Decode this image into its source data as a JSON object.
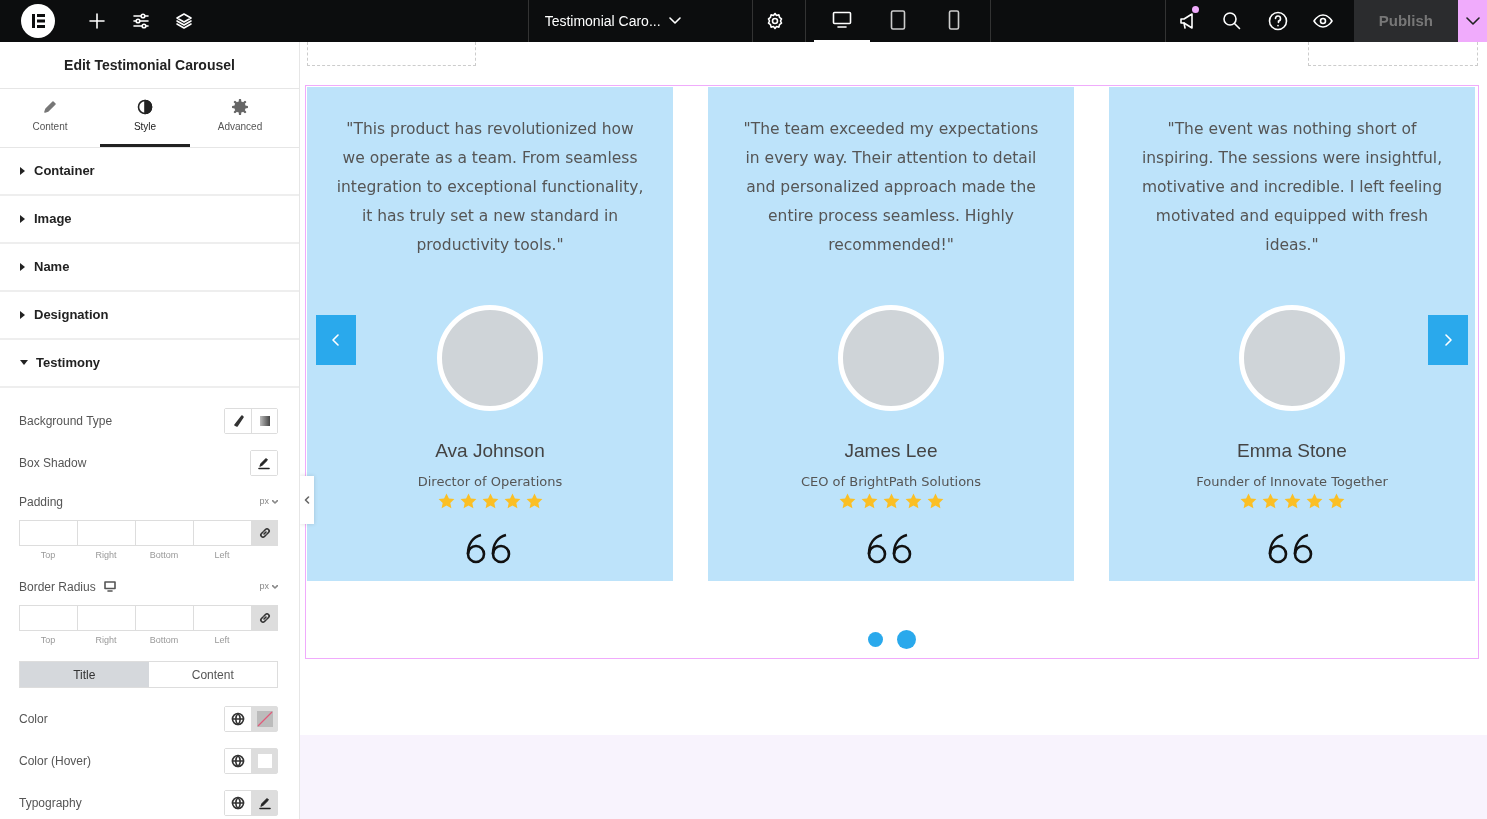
{
  "topbar": {
    "document_title": "Testimonial Caro...",
    "publish": "Publish",
    "devices": [
      {
        "kind": "desktop",
        "selected": true
      },
      {
        "kind": "tablet",
        "selected": false
      },
      {
        "kind": "mobile",
        "selected": false
      }
    ],
    "notification": true
  },
  "panel": {
    "title": "Edit Testimonial Carousel",
    "tabs": [
      {
        "label": "Content",
        "kind": "content",
        "selected": false
      },
      {
        "label": "Style",
        "kind": "style",
        "selected": true
      },
      {
        "label": "Advanced",
        "kind": "advanced",
        "selected": false
      }
    ],
    "sections": [
      {
        "label": "Container",
        "expanded": false
      },
      {
        "label": "Image",
        "expanded": false
      },
      {
        "label": "Name",
        "expanded": false
      },
      {
        "label": "Designation",
        "expanded": false
      },
      {
        "label": "Testimony",
        "expanded": true
      }
    ],
    "controls": [
      {
        "kind": "choose",
        "label": "Background Type"
      },
      {
        "kind": "edit",
        "label": "Box Shadow"
      },
      {
        "kind": "dimensions",
        "label": "Padding",
        "unit": "px",
        "responsive": false,
        "sides": [
          "Top",
          "Right",
          "Bottom",
          "Left"
        ]
      },
      {
        "kind": "dimensions",
        "label": "Border Radius",
        "unit": "px",
        "responsive": true,
        "sides": [
          "Top",
          "Right",
          "Bottom",
          "Left"
        ]
      },
      {
        "kind": "switch",
        "options": [
          {
            "label": "Title",
            "selected": true
          },
          {
            "label": "Content",
            "selected": false
          }
        ]
      },
      {
        "kind": "color",
        "label": "Color",
        "cleared": true
      },
      {
        "kind": "color",
        "label": "Color (Hover)",
        "cleared": false
      },
      {
        "kind": "typography",
        "label": "Typography"
      }
    ]
  },
  "carousel": {
    "slides": [
      {
        "quote": "\"This product has revolutionized how we operate as a team. From seamless integration to exceptional functionality, it has truly set a new standard in productivity tools.\"",
        "name": "Ava Johnson",
        "designation": "Director of Operations",
        "stars": 5
      },
      {
        "quote": "\"The team exceeded my expectations in every way. Their attention to detail and personalized approach made the entire process seamless. Highly recommended!\"",
        "name": "James Lee",
        "designation": "CEO of BrightPath Solutions",
        "stars": 5
      },
      {
        "quote": "\"The event was nothing short of inspiring. The sessions were insightful, motivative and incredible. I left feeling motivated and equipped with fresh ideas.\"",
        "name": "Emma Stone",
        "designation": "Founder of Innovate Together",
        "stars": 5
      }
    ],
    "dots": [
      {
        "selected": false
      },
      {
        "selected": true
      }
    ]
  }
}
